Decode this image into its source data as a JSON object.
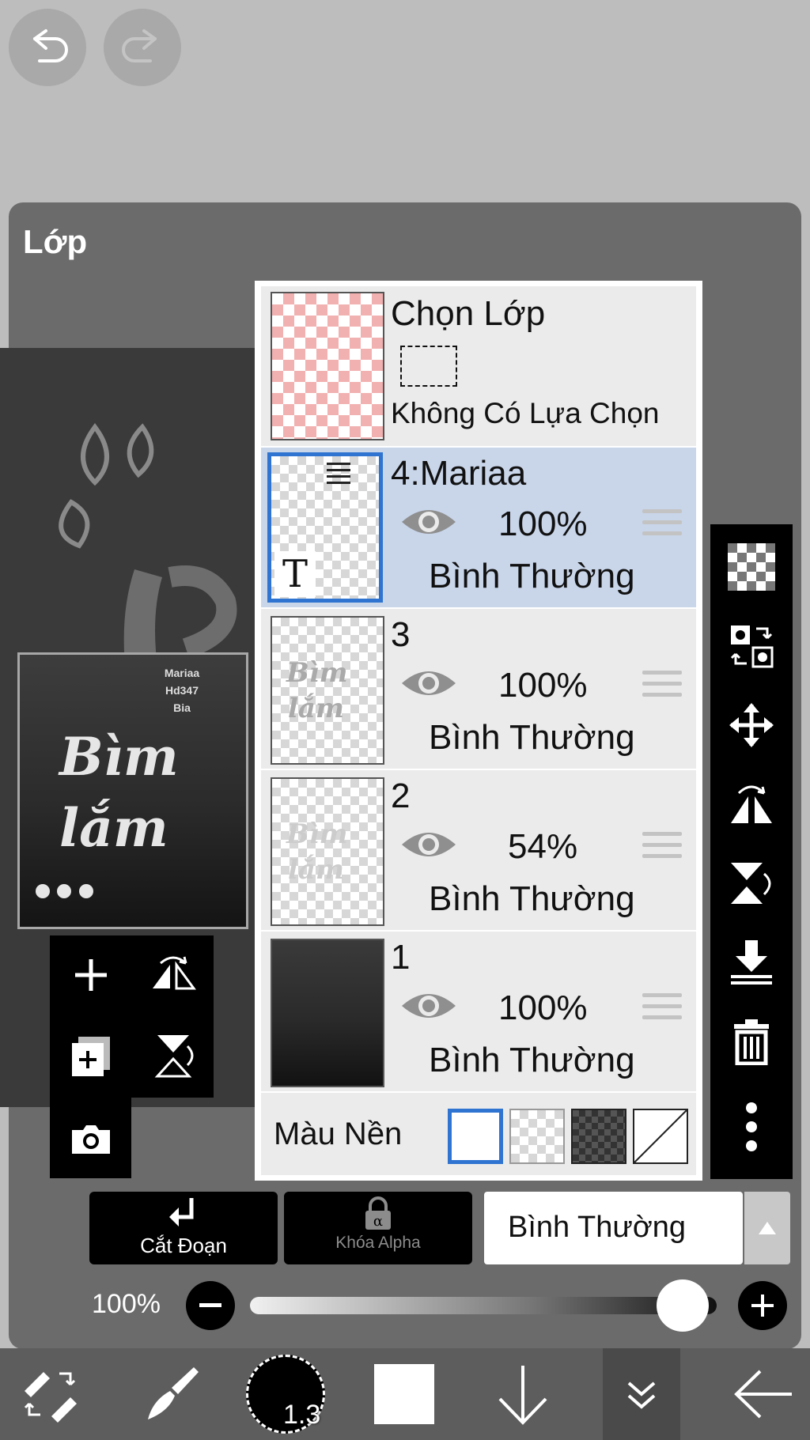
{
  "panel": {
    "title": "Lớp"
  },
  "selection_layer": {
    "title": "Chọn Lớp",
    "subtitle": "Không Có Lựa Chọn"
  },
  "layers": [
    {
      "name": "4:Mariaa",
      "opacity": "100%",
      "blend": "Bình Thường",
      "selected": true,
      "text_badge": "T"
    },
    {
      "name": "3",
      "opacity": "100%",
      "blend": "Bình Thường",
      "selected": false
    },
    {
      "name": "2",
      "opacity": "54%",
      "blend": "Bình Thường",
      "selected": false
    },
    {
      "name": "1",
      "opacity": "100%",
      "blend": "Bình Thường",
      "selected": false
    }
  ],
  "background": {
    "label": "Màu Nền"
  },
  "preview": {
    "text_lines": [
      "Mariaa",
      "Hd347",
      "Bia"
    ],
    "art_line1": "Bìm",
    "art_line2": "lắm"
  },
  "controls": {
    "clip_label": "Cắt Đoạn",
    "alpha_lock_label": "Khóa Alpha",
    "blend_mode": "Bình Thường",
    "opacity_label": "100%",
    "opacity_value": 1.0
  },
  "bottom_toolbar": {
    "brush_size": "1.3"
  },
  "colors": {
    "accent": "#2f74d0",
    "panel": "#6b6b6b",
    "selected_row": "#c9d6ea"
  },
  "icons": [
    "undo-icon",
    "redo-icon",
    "add-layer-icon",
    "duplicate-layer-icon",
    "camera-icon",
    "flip-horizontal-icon",
    "flip-vertical-icon",
    "transparency-icon",
    "swap-layers-icon",
    "move-icon",
    "merge-down-icon",
    "delete-icon",
    "more-icon",
    "lock-icon",
    "eye-icon"
  ]
}
